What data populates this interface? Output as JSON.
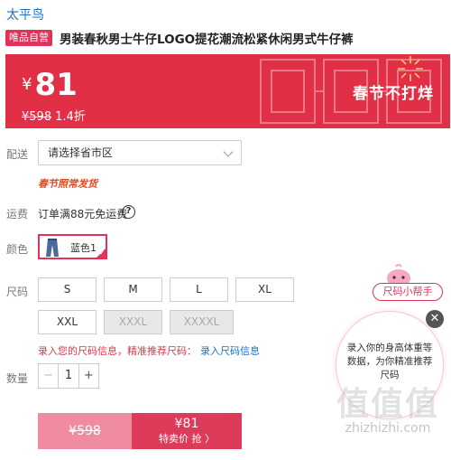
{
  "brand": "太平鸟",
  "badge": "唯品自营",
  "title": "男装春秋男士牛仔LOGO提花潮流松紧休闲男式牛仔裤",
  "banner": {
    "currency": "¥",
    "price": "81",
    "original_price": "¥598",
    "discount": "1.4折",
    "promo_text": "春节不打烊"
  },
  "delivery": {
    "label": "配送",
    "placeholder": "请选择省市区",
    "note": "春节照常发货"
  },
  "freight": {
    "label": "运费",
    "text": "订单满88元免运费",
    "help_icon": "?"
  },
  "color": {
    "label": "颜色",
    "selected": "蓝色1"
  },
  "size": {
    "label": "尺码",
    "options": [
      "S",
      "M",
      "L",
      "XL",
      "XXL",
      "XXXL",
      "XXXXL"
    ],
    "hint": "录入您的尺码信息，精准推荐尺码：",
    "hint_link": "录入尺码信息"
  },
  "quantity": {
    "label": "数量",
    "minus": "−",
    "value": "1",
    "plus": "+"
  },
  "buy": {
    "original": "¥598",
    "price": "¥81",
    "action": "特卖价 抢 〉"
  },
  "helper": {
    "pill": "尺码小帮手",
    "text": "录入你的身高体重等数据，为你精准推荐尺码",
    "close": "✕"
  },
  "watermark": {
    "big": "值值值",
    "small": "zhizhizhi.com"
  },
  "colors": {
    "accent": "#e1325a",
    "banner": "#e12f45",
    "link": "#1a73c8"
  }
}
